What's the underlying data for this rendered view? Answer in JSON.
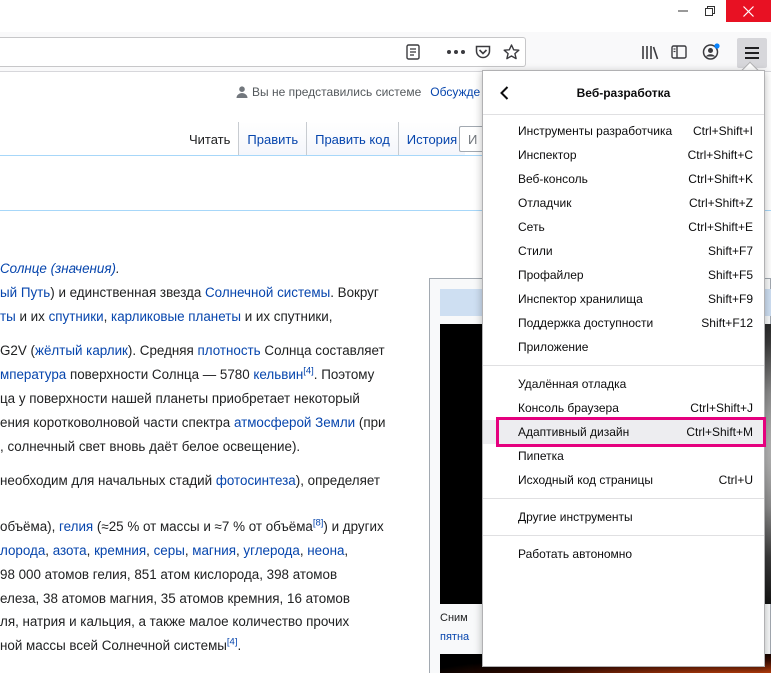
{
  "window": {
    "minimize_icon": "minimize-icon",
    "restore_icon": "restore-icon",
    "close_icon": "close-icon"
  },
  "toolbar": {
    "icons": [
      "reader-mode-icon",
      "page-actions-icon",
      "pocket-icon",
      "bookmark-star-icon",
      "library-icon",
      "sidebar-icon",
      "account-icon",
      "hamburger-menu-icon"
    ]
  },
  "wiki": {
    "user_text": "Вы не представились системе",
    "discuss_text": "Обсужде",
    "tabs": [
      "Читать",
      "Править",
      "Править код",
      "История"
    ],
    "search_partial": "И",
    "lines": [
      {
        "parts": [
          {
            "t": "Солнце (значения)",
            "l": true
          },
          {
            "t": ".",
            "l": false
          }
        ],
        "cls": "hatnote"
      },
      {
        "parts": [
          {
            "t": "ый Путь",
            "l": true
          },
          {
            "t": ") и единственная звезда ",
            "l": false
          },
          {
            "t": "Солнечной системы",
            "l": true
          },
          {
            "t": ". Вокруг",
            "l": false
          }
        ]
      },
      {
        "parts": [
          {
            "t": "ты",
            "l": true
          },
          {
            "t": " и их ",
            "l": false
          },
          {
            "t": "спутники",
            "l": true
          },
          {
            "t": ", ",
            "l": false
          },
          {
            "t": "карликовые планеты",
            "l": true
          },
          {
            "t": " и их спутники,",
            "l": false
          }
        ]
      },
      {
        "parts": [],
        "gap": true
      },
      {
        "parts": [
          {
            "t": "G2V (",
            "l": false
          },
          {
            "t": "жёлтый карлик",
            "l": true
          },
          {
            "t": "). Средняя ",
            "l": false
          },
          {
            "t": "плотность",
            "l": true
          },
          {
            "t": " Солнца составляет",
            "l": false
          }
        ]
      },
      {
        "parts": [
          {
            "t": "мпература",
            "l": true
          },
          {
            "t": " поверхности Солнца — 5780 ",
            "l": false
          },
          {
            "t": "кельвин",
            "l": true
          },
          {
            "t": "[4]",
            "l": true,
            "sup": true
          },
          {
            "t": ". Поэтому",
            "l": false
          }
        ]
      },
      {
        "parts": [
          {
            "t": "ца у поверхности нашей планеты приобретает некоторый",
            "l": false
          }
        ]
      },
      {
        "parts": [
          {
            "t": "ения коротковолновой части спектра ",
            "l": false
          },
          {
            "t": "атмосферой Земли",
            "l": true
          },
          {
            "t": " (при",
            "l": false
          }
        ]
      },
      {
        "parts": [
          {
            "t": ", солнечный свет вновь даёт белое освещение).",
            "l": false
          }
        ]
      },
      {
        "parts": [],
        "gap": true
      },
      {
        "parts": [
          {
            "t": "необходим для начальных стадий ",
            "l": false
          },
          {
            "t": "фотосинтеза",
            "l": true
          },
          {
            "t": "), определяет",
            "l": false
          }
        ]
      },
      {
        "parts": [],
        "gap": true
      },
      {
        "parts": [],
        "gap": true
      },
      {
        "parts": [
          {
            "t": "объёма), ",
            "l": false
          },
          {
            "t": "гелия",
            "l": true
          },
          {
            "t": " (≈25 % от массы и ≈7 % от объёма",
            "l": false
          },
          {
            "t": "[8]",
            "l": true,
            "sup": true
          },
          {
            "t": ") и других",
            "l": false
          }
        ]
      },
      {
        "parts": [
          {
            "t": "лорода",
            "l": true
          },
          {
            "t": ", ",
            "l": false
          },
          {
            "t": "азота",
            "l": true
          },
          {
            "t": ", ",
            "l": false
          },
          {
            "t": "кремния",
            "l": true
          },
          {
            "t": ", ",
            "l": false
          },
          {
            "t": "серы",
            "l": true
          },
          {
            "t": ", ",
            "l": false
          },
          {
            "t": "магния",
            "l": true
          },
          {
            "t": ", ",
            "l": false
          },
          {
            "t": "углерода",
            "l": true
          },
          {
            "t": ", ",
            "l": false
          },
          {
            "t": "неона",
            "l": true
          },
          {
            "t": ",",
            "l": false
          }
        ]
      },
      {
        "parts": [
          {
            "t": "98 000 атомов гелия, 851 атом кислорода, 398 атомов",
            "l": false
          }
        ]
      },
      {
        "parts": [
          {
            "t": "елеза, 38 атомов магния, 35 атомов кремния, 16 атомов",
            "l": false
          }
        ]
      },
      {
        "parts": [
          {
            "t": "ля, натрия и кальция, а также малое количество прочих",
            "l": false
          }
        ]
      },
      {
        "parts": [
          {
            "t": "ной массы всей Солнечной системы",
            "l": false
          },
          {
            "t": "[4]",
            "l": true,
            "sup": true
          },
          {
            "t": ".",
            "l": false
          }
        ]
      }
    ],
    "infobox_caption_1": "Сним",
    "infobox_caption_2": "пятна"
  },
  "panel": {
    "back_icon": "back-arrow-icon",
    "title": "Веб-разработка",
    "groups": [
      [
        {
          "label": "Инструменты разработчика",
          "shortcut": "Ctrl+Shift+I"
        },
        {
          "label": "Инспектор",
          "shortcut": "Ctrl+Shift+C"
        },
        {
          "label": "Веб-консоль",
          "shortcut": "Ctrl+Shift+K"
        },
        {
          "label": "Отладчик",
          "shortcut": "Ctrl+Shift+Z"
        },
        {
          "label": "Сеть",
          "shortcut": "Ctrl+Shift+E"
        },
        {
          "label": "Стили",
          "shortcut": "Shift+F7"
        },
        {
          "label": "Профайлер",
          "shortcut": "Shift+F5"
        },
        {
          "label": "Инспектор хранилища",
          "shortcut": "Shift+F9"
        },
        {
          "label": "Поддержка доступности",
          "shortcut": "Shift+F12"
        },
        {
          "label": "Приложение",
          "shortcut": ""
        }
      ],
      [
        {
          "label": "Удалённая отладка",
          "shortcut": ""
        },
        {
          "label": "Консоль браузера",
          "shortcut": "Ctrl+Shift+J"
        },
        {
          "label": "Адаптивный дизайн",
          "shortcut": "Ctrl+Shift+M",
          "highlighted": true
        },
        {
          "label": "Пипетка",
          "shortcut": ""
        },
        {
          "label": "Исходный код страницы",
          "shortcut": "Ctrl+U"
        }
      ],
      [
        {
          "label": "Другие инструменты",
          "shortcut": ""
        }
      ],
      [
        {
          "label": "Работать автономно",
          "shortcut": ""
        }
      ]
    ],
    "highlight_color": "#e5007e"
  }
}
